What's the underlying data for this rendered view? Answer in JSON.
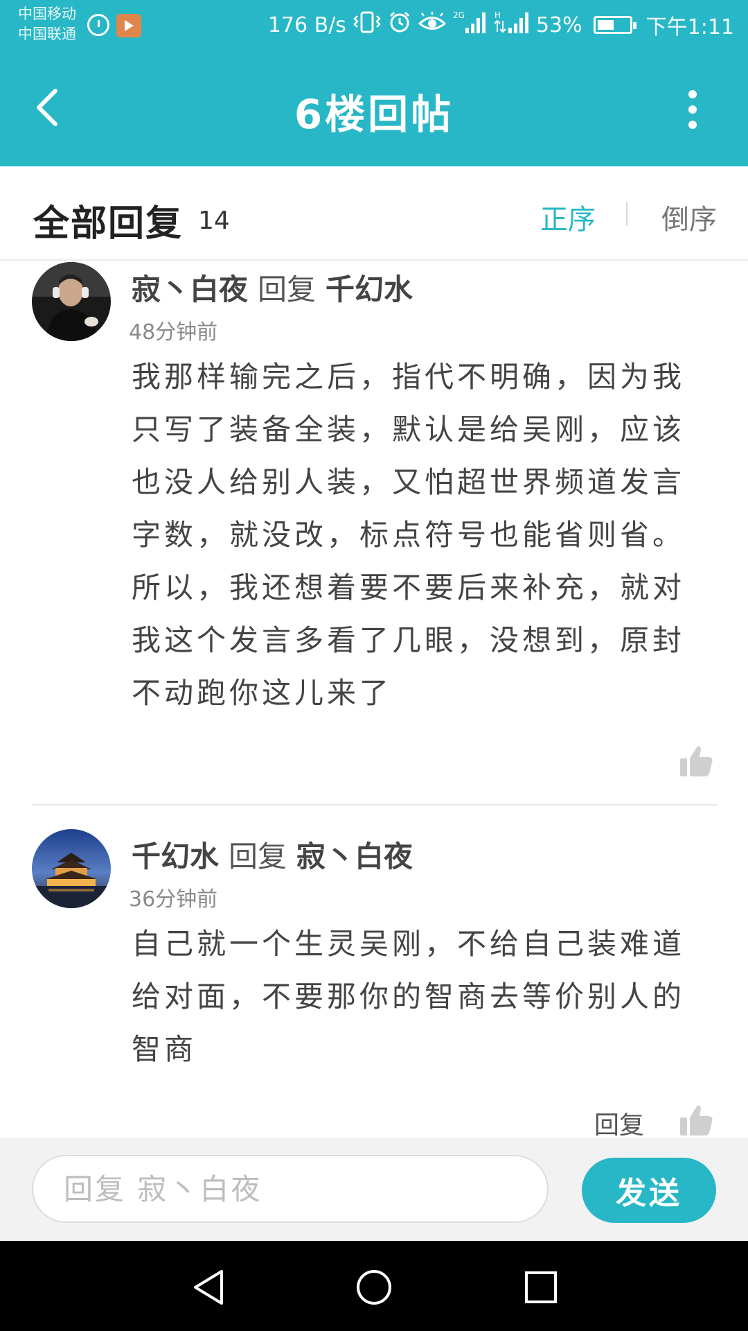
{
  "status_bar": {
    "carrier_1": "中国移动",
    "carrier_2": "中国联通",
    "speed": "176 B/s",
    "signal_2g": "2G",
    "signal_h": "H",
    "battery_pct": "53%",
    "battery_level": 0.53,
    "time": "下午1:11"
  },
  "header": {
    "title": "6楼回帖"
  },
  "section": {
    "title": "全部回复",
    "count": "14",
    "sort_asc": "正序",
    "sort_desc": "倒序"
  },
  "replies": [
    {
      "author": "寂丶白夜",
      "reply_word": "回复",
      "target": "千幻水",
      "time": "48分钟前",
      "body": "我那样输完之后，指代不明确，因为我只写了装备全装，默认是给吴刚，应该也没人给别人装，又怕超世界频道发言字数，就没改，标点符号也能省则省。所以，我还想着要不要后来补充，就对我这个发言多看了几眼，没想到，原封不动跑你这儿来了"
    },
    {
      "author": "千幻水",
      "reply_word": "回复",
      "target": "寂丶白夜",
      "time": "36分钟前",
      "body": "自己就一个生灵吴刚，不给自己装难道给对面，不要那你的智商去等价别人的智商",
      "reply_link": "回复"
    }
  ],
  "input_bar": {
    "placeholder": "回复 寂丶白夜",
    "send_label": "发送"
  },
  "colors": {
    "accent": "#28b7c6",
    "nav": "#000000"
  }
}
